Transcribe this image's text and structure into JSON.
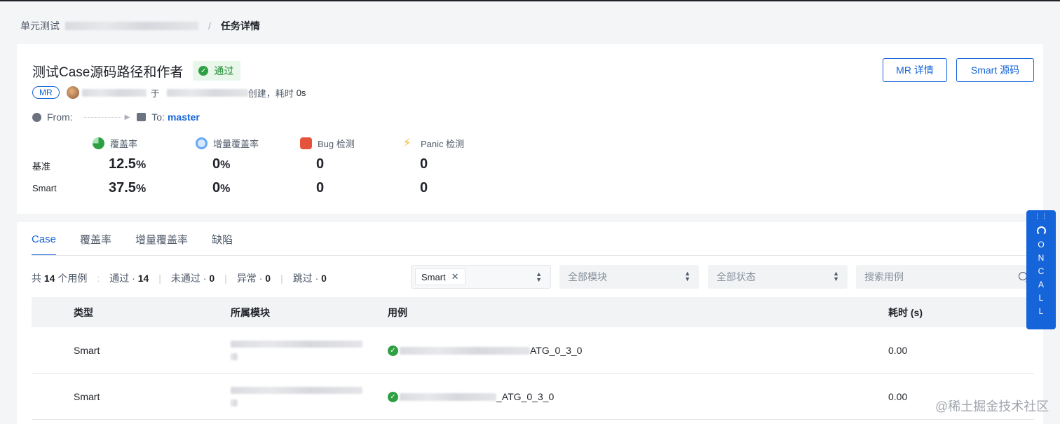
{
  "breadcrumb": {
    "root": "单元测试",
    "separator": "/",
    "current": "任务详情"
  },
  "task": {
    "title": "测试Case源码路径和作者",
    "status": "通过",
    "mr_tag": "MR",
    "meta_at": "于",
    "meta_created": "创建，耗时",
    "meta_duration": "0s",
    "from_label": "From:",
    "to_label": "To:",
    "to_branch": "master"
  },
  "actions": {
    "mr_detail": "MR 详情",
    "smart_source": "Smart 源码"
  },
  "metrics": {
    "headers": {
      "coverage": "覆盖率",
      "incremental": "增量覆盖率",
      "bug": "Bug 检测",
      "panic": "Panic 检测"
    },
    "rows": [
      {
        "label": "基准",
        "coverage": "12.5",
        "incremental": "0",
        "bug": "0",
        "panic": "0"
      },
      {
        "label": "Smart",
        "coverage": "37.5",
        "incremental": "0",
        "bug": "0",
        "panic": "0"
      }
    ],
    "pct_symbol": "%"
  },
  "tabs": [
    {
      "label": "Case",
      "active": true
    },
    {
      "label": "覆盖率",
      "active": false
    },
    {
      "label": "增量覆盖率",
      "active": false
    },
    {
      "label": "缺陷",
      "active": false
    }
  ],
  "summary": {
    "total_prefix": "共",
    "total": "14",
    "total_suffix": "个用例",
    "passed_label": "通过 ·",
    "passed": "14",
    "failed_label": "未通过 ·",
    "failed": "0",
    "error_label": "异常 ·",
    "error": "0",
    "skipped_label": "跳过 ·",
    "skipped": "0"
  },
  "filters": {
    "type_chip": "Smart",
    "module_placeholder": "全部模块",
    "status_placeholder": "全部状态",
    "search_placeholder": "搜索用例"
  },
  "table": {
    "columns": {
      "type": "类型",
      "module": "所属模块",
      "case": "用例",
      "time": "耗时 (s)"
    },
    "rows": [
      {
        "type": "Smart",
        "case_suffix": "ATG_0_3_0",
        "time": "0.00"
      },
      {
        "type": "Smart",
        "case_suffix": "_ATG_0_3_0",
        "time": "0.00"
      }
    ]
  },
  "oncall": {
    "letters": [
      "O",
      "N",
      "C",
      "A",
      "L",
      "L"
    ]
  },
  "watermark": "@稀土掘金技术社区",
  "colors": {
    "primary": "#1664d9",
    "success": "#2ea043",
    "background": "#f4f5f7"
  }
}
